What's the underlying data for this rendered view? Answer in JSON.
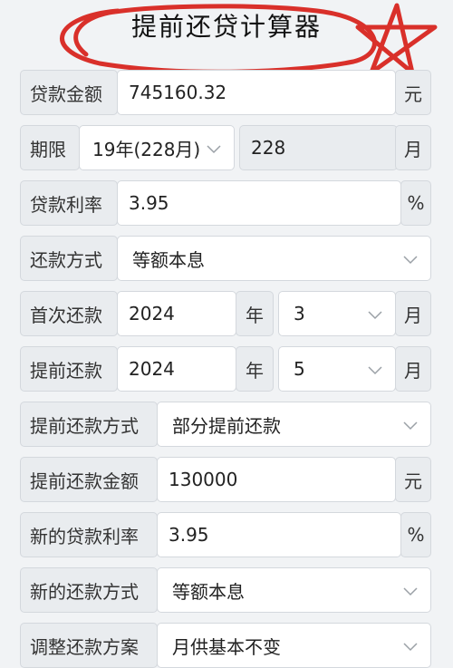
{
  "header": {
    "title": "提前还贷计算器"
  },
  "form": {
    "loan_amount": {
      "label": "贷款金额",
      "value": "745160.32",
      "unit": "元"
    },
    "term": {
      "label": "期限",
      "select": "19年(228月)",
      "value": "228",
      "unit": "月"
    },
    "rate": {
      "label": "贷款利率",
      "value": "3.95",
      "unit": "%"
    },
    "repay_method": {
      "label": "还款方式",
      "select": "等额本息"
    },
    "first_repay": {
      "label": "首次还款",
      "year": "2024",
      "year_unit": "年",
      "month": "3",
      "month_unit": "月"
    },
    "prepay_date": {
      "label": "提前还款",
      "year": "2024",
      "year_unit": "年",
      "month": "5",
      "month_unit": "月"
    },
    "prepay_method": {
      "label": "提前还款方式",
      "select": "部分提前还款"
    },
    "prepay_amount": {
      "label": "提前还款金额",
      "value": "130000",
      "unit": "元"
    },
    "new_rate": {
      "label": "新的贷款利率",
      "value": "3.95",
      "unit": "%"
    },
    "new_method": {
      "label": "新的还款方式",
      "select": "等额本息"
    },
    "adjust_plan": {
      "label": "调整还款方案",
      "select": "月供基本不变"
    }
  },
  "colors": {
    "annotation": "#d9302a",
    "label_bg": "#e9ecef",
    "border": "#d4d8dd"
  },
  "icons": {
    "dropdown": "chevron-down-icon"
  }
}
